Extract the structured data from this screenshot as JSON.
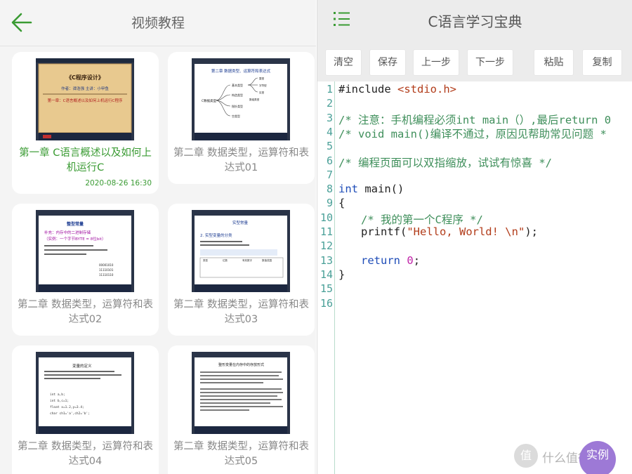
{
  "left": {
    "title": "视频教程",
    "icons": {
      "back": "back-arrow-icon"
    },
    "accent_color": "#3a9b33",
    "videos": [
      {
        "title": "第一章 C语言概述以及如何上机运行C",
        "date": "2020-08-26 16:30",
        "active": true,
        "slide": {
          "heading": "《C程序设计》",
          "author": "作者：谭浩强  主讲：小甲鱼",
          "subtitle": "第一章：C语言概述以及如何上机运行C程序"
        }
      },
      {
        "title": "第二章 数据类型，运算符和表达式01",
        "slide": {
          "heading": "第二章 数据类型、运算符和表达式",
          "center": "C数据类型",
          "branches": [
            "基本类型",
            "构造类型",
            "指针类型",
            "空类型"
          ],
          "leaves": [
            "整型",
            "字符型",
            "实型",
            "枚举型",
            "数组类型",
            "结构体类型",
            "共用体类型"
          ]
        }
      },
      {
        "title": "第二章 数据类型，运算符和表达式02",
        "slide": {
          "heading": "整型常量",
          "subtitle": "补充：内存中的二进制存储",
          "example": "（实例：一个字节BYTE = 8位bit）",
          "values": [
            "00001010",
            "11110101",
            "11110110"
          ]
        }
      },
      {
        "title": "第二章 数据类型，运算符和表达式03",
        "slide": {
          "heading": "实型常量",
          "subtitle": "2. 实型变量的分类",
          "table_header": [
            "类型",
            "位数",
            "有效数字",
            "数值范围"
          ]
        }
      },
      {
        "title": "第二章 数据类型，运算符和表达式04",
        "slide": {
          "heading": "变量的定义",
          "code": [
            "int a,b;",
            "int b,c=1;",
            "float x=1.2,y=3.4;",
            "char ch1='a',ch2='b';"
          ]
        }
      },
      {
        "title": "第二章 数据类型，运算符和表达式05",
        "slide": {
          "heading": "整形变量在内存中的存放形式"
        }
      }
    ]
  },
  "right": {
    "title": "C语言学习宝典",
    "icons": {
      "menu": "menu-list-icon"
    },
    "toolbar": [
      "清空",
      "保存",
      "上一步",
      "下一步",
      "粘贴",
      "复制"
    ],
    "line_numbers": [
      "1",
      "2",
      "3",
      "4",
      "5",
      "6",
      "7",
      "8",
      "9",
      "10",
      "11",
      "12",
      "13",
      "14",
      "15",
      "16"
    ],
    "code": {
      "l1_pre": "#include ",
      "l1_hdr": "<stdio.h>",
      "l3": "/* 注意：手机编程必须int main（）,最后return 0",
      "l4": "/* void main()编译不通过，原因见帮助常见问题 *",
      "l6": "/* 编程页面可以双指缩放，试试有惊喜 */",
      "l8_kw": "int",
      "l8_rest": " main()",
      "l9": "{",
      "l10": "/* 我的第一个C程序 */",
      "l11_pre": "printf(",
      "l11_str": "\"Hello, World! \\n\"",
      "l11_post": ");",
      "l13_kw": "return",
      "l13_num": "0",
      "l13_post": ";",
      "l14": "}"
    },
    "fab_label": "实例"
  },
  "watermark": {
    "logo": "值",
    "text": "什么值得买"
  }
}
